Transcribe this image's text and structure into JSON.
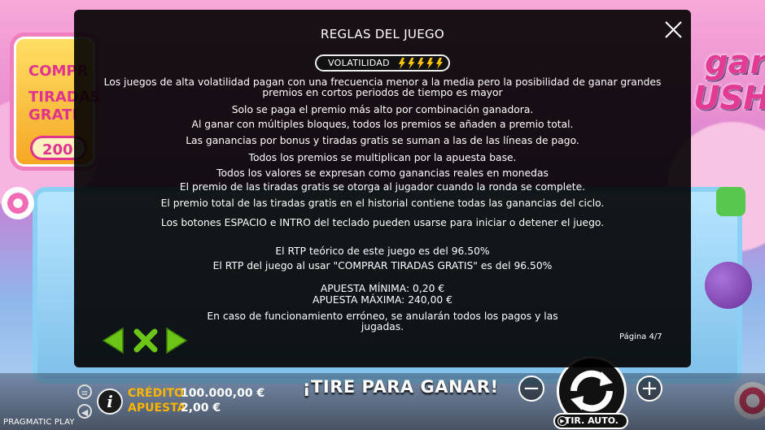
{
  "overlay": {
    "title": "REGLAS DEL JUEGO",
    "volatility_label": "VOLATILIDAD",
    "volatility_level": 5,
    "volatility_max": 5,
    "paragraphs": [
      "Los juegos de alta volatilidad pagan con una frecuencia menor a la media pero la posibilidad de ganar grandes premios en cortos periodos de tiempo es mayor",
      "Solo se paga el premio más alto por combinación ganadora.",
      "Al ganar con múltiples bloques, todos los premios se añaden a premio total.",
      "Las ganancias por bonus y tiradas gratis se suman a las de las líneas de pago.",
      "Todos los premios se multiplican por la apuesta base.",
      "Todos los valores se expresan como ganancias reales en monedas",
      "El premio de las tiradas gratis se otorga al jugador cuando la ronda se complete.",
      "El premio total de las tiradas gratis en el historial contiene todas las ganancias del ciclo.",
      "Los botones ESPACIO e INTRO del teclado pueden usarse para iniciar o detener el juego.",
      "El RTP teórico de este juego es del 96.50%",
      "El RTP del juego al usar \"COMPRAR TIRADAS GRATIS\" es del 96.50%",
      "APUESTA MÍNIMA: 0,20 €",
      "APUESTA MÁXIMA: 240,00 €",
      "En caso de funcionamiento erróneo, se anularán todos los pagos y las jugadas."
    ],
    "page_indicator": "Página 4/7"
  },
  "background": {
    "promo_lines": [
      "COMPR",
      "TIRADAS",
      "GRATI",
      "200"
    ],
    "logo_lines": [
      "gar",
      "USH"
    ]
  },
  "bottom_bar": {
    "credit_label": "CRÉDITO",
    "credit_value": "100.000,00 €",
    "bet_label": "APUESTA",
    "bet_value": "2,00 €",
    "banner": "¡TIRE PARA GANAR!",
    "autoplay_label": "TIR. AUTO.",
    "provider": "PRAGMATIC PLAY",
    "minus_symbol": "−",
    "plus_symbol": "+"
  },
  "colors": {
    "accent_yellow": "#ffb400",
    "nav_green": "#6cc417",
    "overlay_bg": "#000000"
  }
}
